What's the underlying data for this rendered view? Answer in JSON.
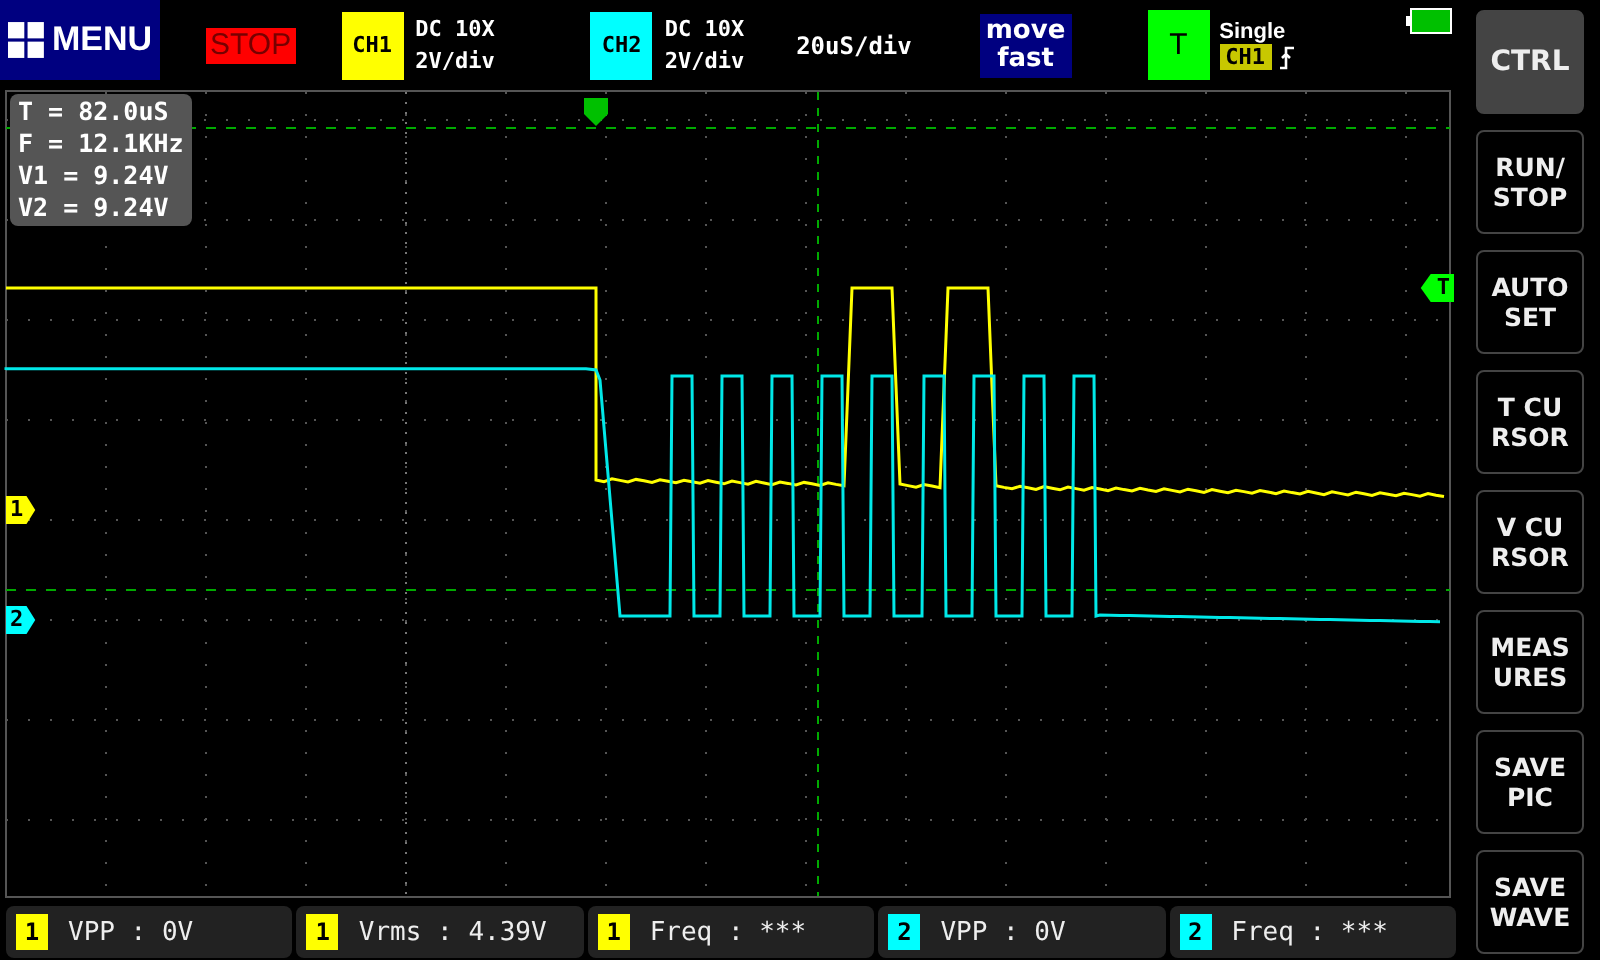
{
  "top_bar": {
    "menu": {
      "label": "MENU"
    },
    "run_state": "STOP",
    "channels": [
      {
        "label": "CH1",
        "color": "#ffff00",
        "coupling": "DC 10X",
        "scale": "2V/div"
      },
      {
        "label": "CH2",
        "color": "#00ffff",
        "coupling": "DC 10X",
        "scale": "2V/div"
      }
    ],
    "timebase": "20uS/div",
    "move_mode": [
      "move",
      "fast"
    ],
    "trigger": {
      "label": "T",
      "mode": "Single",
      "source": "CH1"
    }
  },
  "readout": [
    "T = 82.0uS",
    "F = 12.1KHz",
    "V1 = 9.24V",
    "V2 = 9.24V"
  ],
  "markers": [
    {
      "label": "1",
      "color": "#ffff00"
    },
    {
      "label": "2",
      "color": "#00ffff"
    },
    {
      "label": "T",
      "color": "#00ff00"
    }
  ],
  "side_buttons": [
    {
      "lines": [
        "CTRL"
      ],
      "selected": true
    },
    {
      "lines": [
        "RUN/",
        "STOP"
      ],
      "selected": false
    },
    {
      "lines": [
        "AUTO",
        "SET"
      ],
      "selected": false
    },
    {
      "lines": [
        "T CU",
        "RSOR"
      ],
      "selected": false
    },
    {
      "lines": [
        "V CU",
        "RSOR"
      ],
      "selected": false
    },
    {
      "lines": [
        "MEAS",
        "URES"
      ],
      "selected": false
    },
    {
      "lines": [
        "SAVE",
        "PIC"
      ],
      "selected": false
    },
    {
      "lines": [
        "SAVE",
        "WAVE"
      ],
      "selected": false
    }
  ],
  "measurements": [
    {
      "channel": "1",
      "color": "#ffff00",
      "text": "VPP : 0V"
    },
    {
      "channel": "1",
      "color": "#ffff00",
      "text": "Vrms : 4.39V"
    },
    {
      "channel": "1",
      "color": "#ffff00",
      "text": "Freq : ***"
    },
    {
      "channel": "2",
      "color": "#00ffff",
      "text": "VPP : 0V"
    },
    {
      "channel": "2",
      "color": "#00ffff",
      "text": "Freq : ***"
    }
  ]
}
